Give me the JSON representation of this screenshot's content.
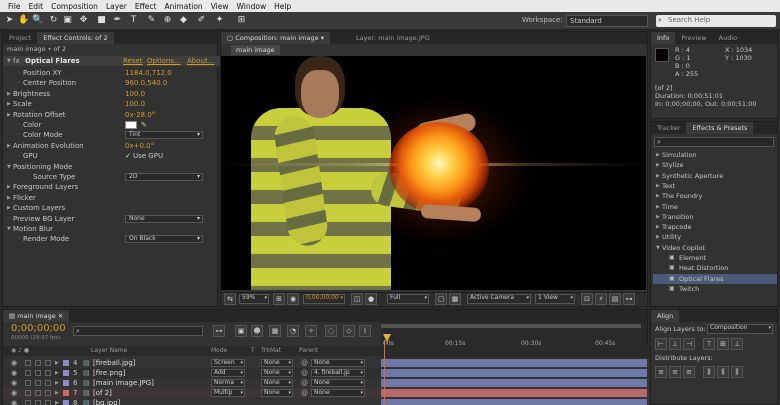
{
  "menu": [
    "File",
    "Edit",
    "Composition",
    "Layer",
    "Effect",
    "Animation",
    "View",
    "Window",
    "Help"
  ],
  "toolbar": {
    "workspace_label": "Workspace:",
    "workspace_value": "Standard",
    "search_placeholder": "Search Help"
  },
  "left_panel": {
    "tabs": [
      "Project",
      "Effect Controls: of 2"
    ],
    "subtitle": "main image • of 2",
    "effect_name": "Optical Flares",
    "reset": "Reset",
    "options": "Options...",
    "about": "About...",
    "props": [
      {
        "label": "Position XY",
        "value": "1184.0,712.0"
      },
      {
        "label": "Center Position",
        "value": "960.0,540.0"
      },
      {
        "label": "Brightness",
        "value": "100.0"
      },
      {
        "label": "Scale",
        "value": "100.0"
      },
      {
        "label": "Rotation Offset",
        "value": "0x-28.0°"
      },
      {
        "label": "Color",
        "value": ""
      },
      {
        "label": "Color Mode",
        "value": "Tint"
      },
      {
        "label": "Animation Evolution",
        "value": "0x+0.0°"
      },
      {
        "label": "GPU",
        "value": "Use GPU"
      },
      {
        "label": "Positioning Mode",
        "value": ""
      },
      {
        "label": "Source Type",
        "value": "2D"
      },
      {
        "label": "Foreground Layers",
        "value": ""
      },
      {
        "label": "Flicker",
        "value": ""
      },
      {
        "label": "Custom Layers",
        "value": ""
      },
      {
        "label": "Preview BG Layer",
        "value": "None"
      },
      {
        "label": "Motion Blur",
        "value": ""
      },
      {
        "label": "Render Mode",
        "value": "On Black"
      }
    ]
  },
  "comp_panel": {
    "tab_comp": "Composition: main image",
    "tab_layer": "Layer: main image.JPG",
    "subtab": "main image",
    "zoom": "59%",
    "timecode": "0;00;00;00",
    "resolution": "Full",
    "camera": "Active Camera",
    "views": "1 View"
  },
  "info_panel": {
    "tabs": [
      "Info",
      "Preview",
      "Audio"
    ],
    "r": "R : 4",
    "g": "G : 1",
    "b": "B : 0",
    "a": "A : 255",
    "x": "X : 1034",
    "y": "Y : 1030",
    "layer": "[of 2]",
    "duration": "Duration: 0;00;51;01",
    "in_out": "In: 0;00;00;00, Out: 0;00;51;00"
  },
  "effects_panel": {
    "tabs": [
      "Tracker",
      "Effects & Presets"
    ],
    "search_value": "",
    "categories": [
      "Simulation",
      "Stylize",
      "Synthetic Aperture",
      "Text",
      "The Foundry",
      "Time",
      "Transition",
      "Trapcode",
      "Utility",
      "Video Copilot"
    ],
    "items": [
      "Element",
      "Heat Distortion",
      "Optical Flares",
      "Twitch"
    ],
    "selected": "Optical Flares"
  },
  "align_panel": {
    "tab": "Align",
    "align_to_label": "Align Layers to:",
    "align_to_value": "Composition",
    "distribute_label": "Distribute Layers:"
  },
  "timeline": {
    "tab": "main image",
    "timecode": "0;00;00;00",
    "fps": "00000 (29.97 fps)",
    "search_placeholder": "",
    "col_layer_name": "Layer Name",
    "col_mode": "Mode",
    "col_t": "T",
    "col_trkmat": "TrkMat",
    "col_parent": "Parent",
    "ruler": [
      "00s",
      "00:15s",
      "00:30s",
      "00:45s"
    ],
    "layers": [
      {
        "num": "4",
        "name": "[fireball.jpg]",
        "mode": "Screen",
        "trkmat": "None",
        "parent": "None",
        "color": "#8a8acc"
      },
      {
        "num": "5",
        "name": "[fire.png]",
        "mode": "Add",
        "trkmat": "None",
        "parent": "4. fireball.jp",
        "color": "#8a8acc"
      },
      {
        "num": "6",
        "name": "[main image.JPG]",
        "mode": "Norma",
        "trkmat": "None",
        "parent": "None",
        "color": "#8a8acc"
      },
      {
        "num": "7",
        "name": "[of 2]",
        "mode": "Multip",
        "trkmat": "None",
        "parent": "None",
        "color": "#cc6a6a"
      },
      {
        "num": "8",
        "name": "[bg.jpg]",
        "mode": "",
        "trkmat": "",
        "parent": "",
        "color": "#8a8acc"
      }
    ]
  }
}
